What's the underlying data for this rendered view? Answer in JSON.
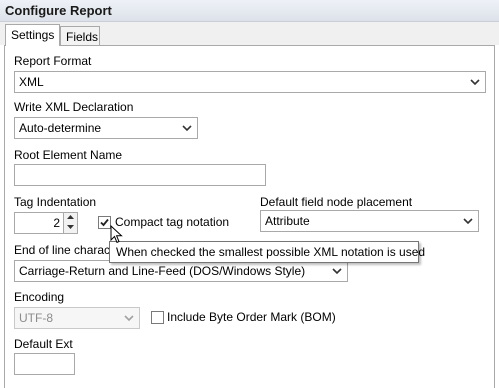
{
  "window": {
    "title": "Configure Report"
  },
  "tabs": [
    {
      "label": "Settings",
      "active": true
    },
    {
      "label": "Fields",
      "active": false
    }
  ],
  "report_format": {
    "label": "Report Format",
    "value": "XML"
  },
  "xml_declaration": {
    "label": "Write XML Declaration",
    "value": "Auto-determine"
  },
  "root_element": {
    "label": "Root Element Name",
    "value": ""
  },
  "tag_indentation": {
    "label": "Tag Indentation",
    "value": "2"
  },
  "compact_tag": {
    "label": "Compact tag notation",
    "checked": true
  },
  "field_node": {
    "label": "Default field node placement",
    "value": "Attribute"
  },
  "end_of_line": {
    "label_visible": "End of line charac",
    "value": "Carriage-Return and Line-Feed (DOS/Windows Style)"
  },
  "encoding": {
    "label": "Encoding",
    "value": "UTF-8",
    "disabled": true
  },
  "bom": {
    "label": "Include Byte Order Mark (BOM)",
    "checked": false
  },
  "default_ext": {
    "label": "Default Ext",
    "value": ""
  },
  "tooltip": {
    "text": "When checked the smallest possible XML notation is used"
  },
  "colors": {
    "border": "#a9a9a9",
    "title_bg": "#e6e9ef",
    "disabled_text": "#8c8c8c"
  },
  "icons": {
    "dropdown": "chevron-down-icon",
    "spin_up": "spin-up-icon",
    "spin_down": "spin-down-icon",
    "check": "checkmark-icon",
    "cursor": "mouse-pointer-icon"
  }
}
